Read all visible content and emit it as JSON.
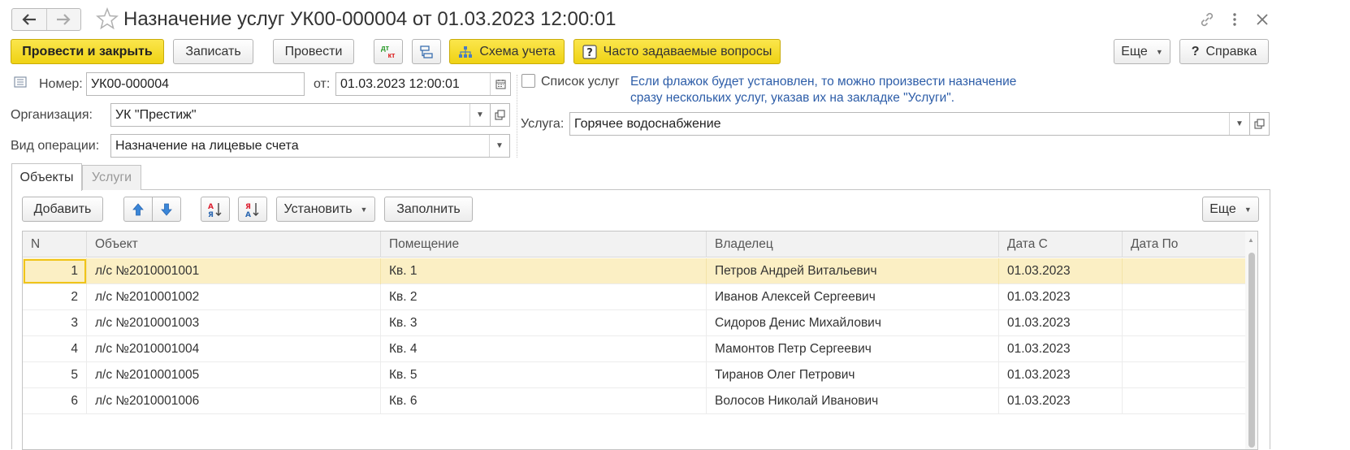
{
  "header": {
    "title": "Назначение услуг УК00-000004 от 01.03.2023 12:00:01"
  },
  "toolbar": {
    "post_close": "Провести и закрыть",
    "save": "Записать",
    "post": "Провести",
    "dtkt_top": "дт",
    "dtkt_bottom": "кт",
    "accounting_scheme": "Схема учета",
    "faq": "Часто задаваемые вопросы",
    "more": "Еще",
    "help": "Справка"
  },
  "form": {
    "number_label": "Номер:",
    "number_value": "УК00-000004",
    "date_label": "от:",
    "date_value": "01.03.2023 12:00:01",
    "organization_label": "Организация:",
    "organization_value": "УК \"Престиж\"",
    "operation_label": "Вид операции:",
    "operation_value": "Назначение на лицевые счета",
    "services_list_label": "Список услуг",
    "services_list_checked": false,
    "hint_line1": "Если флажок будет установлен, то можно произвести назначение",
    "hint_line2": "сразу нескольких услуг, указав их на закладке \"Услуги\".",
    "service_label": "Услуга:",
    "service_value": "Горячее водоснабжение"
  },
  "tabs": [
    {
      "label": "Объекты",
      "active": true
    },
    {
      "label": "Услуги",
      "active": false
    }
  ],
  "table_toolbar": {
    "add": "Добавить",
    "set": "Установить",
    "fill": "Заполнить",
    "more": "Еще"
  },
  "table": {
    "columns": [
      "N",
      "Объект",
      "Помещение",
      "Владелец",
      "Дата С",
      "Дата По"
    ],
    "rows": [
      {
        "n": "1",
        "object": "л/с №2010001001",
        "room": "Кв. 1",
        "owner": "Петров Андрей Витальевич",
        "date_from": "01.03.2023",
        "date_to": ""
      },
      {
        "n": "2",
        "object": "л/с №2010001002",
        "room": "Кв. 2",
        "owner": "Иванов Алексей Сергеевич",
        "date_from": "01.03.2023",
        "date_to": ""
      },
      {
        "n": "3",
        "object": "л/с №2010001003",
        "room": "Кв. 3",
        "owner": "Сидоров Денис Михайлович",
        "date_from": "01.03.2023",
        "date_to": ""
      },
      {
        "n": "4",
        "object": "л/с №2010001004",
        "room": "Кв. 4",
        "owner": "Мамонтов Петр Сергеевич",
        "date_from": "01.03.2023",
        "date_to": ""
      },
      {
        "n": "5",
        "object": "л/с №2010001005",
        "room": "Кв. 5",
        "owner": "Тиранов Олег Петрович",
        "date_from": "01.03.2023",
        "date_to": ""
      },
      {
        "n": "6",
        "object": "л/с №2010001006",
        "room": "Кв. 6",
        "owner": "Волосов Николай Иванович",
        "date_from": "01.03.2023",
        "date_to": ""
      }
    ],
    "selected_row": 0
  },
  "colors": {
    "accent_yellow": "#f5dc2b",
    "hint_blue": "#2d5da8",
    "selected_row": "#fbefc4"
  }
}
